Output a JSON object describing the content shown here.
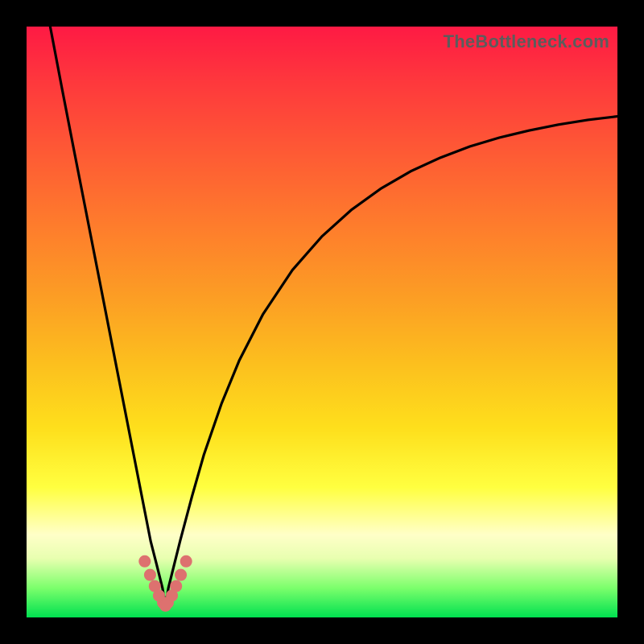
{
  "watermark": "TheBottleneck.com",
  "colors": {
    "frame_bg": "#000000",
    "gradient_top": "#fe1a44",
    "gradient_mid1": "#fc9e24",
    "gradient_mid2": "#ffff40",
    "gradient_bottom": "#00e050",
    "curve_stroke": "#000000",
    "dot_fill": "#dd716f"
  },
  "chart_data": {
    "type": "line",
    "title": "",
    "xlabel": "",
    "ylabel": "",
    "x_range": [
      0,
      100
    ],
    "y_range": [
      0,
      100
    ],
    "notes": "No axes, ticks, or legend are rendered. Background encodes y (low=green near y≈0, high=red near y≈100). Curve minimum (y≈0) occurs near x≈23.5.",
    "series": [
      {
        "name": "bottleneck-curve",
        "x": [
          4,
          6,
          8,
          10,
          12,
          14,
          16,
          18,
          20,
          21,
          22,
          23,
          23.5,
          24,
          25,
          26,
          28,
          30,
          33,
          36,
          40,
          45,
          50,
          55,
          60,
          65,
          70,
          75,
          80,
          85,
          90,
          95,
          100
        ],
        "y": [
          100,
          89.5,
          79.2,
          69,
          58.8,
          48.6,
          38.4,
          28.2,
          18,
          12.9,
          9,
          5,
          2,
          5,
          9,
          13,
          20.5,
          27.5,
          36.2,
          43.5,
          51.3,
          58.8,
          64.5,
          69,
          72.6,
          75.5,
          77.8,
          79.7,
          81.2,
          82.4,
          83.4,
          84.2,
          84.8
        ]
      }
    ],
    "markers": {
      "name": "near-minimum-dots",
      "x": [
        20.0,
        20.9,
        21.7,
        22.4,
        23.1,
        23.5,
        23.9,
        24.6,
        25.3,
        26.1,
        27.0
      ],
      "y": [
        9.5,
        7.2,
        5.3,
        3.7,
        2.5,
        2.0,
        2.5,
        3.7,
        5.3,
        7.2,
        9.5
      ]
    }
  }
}
